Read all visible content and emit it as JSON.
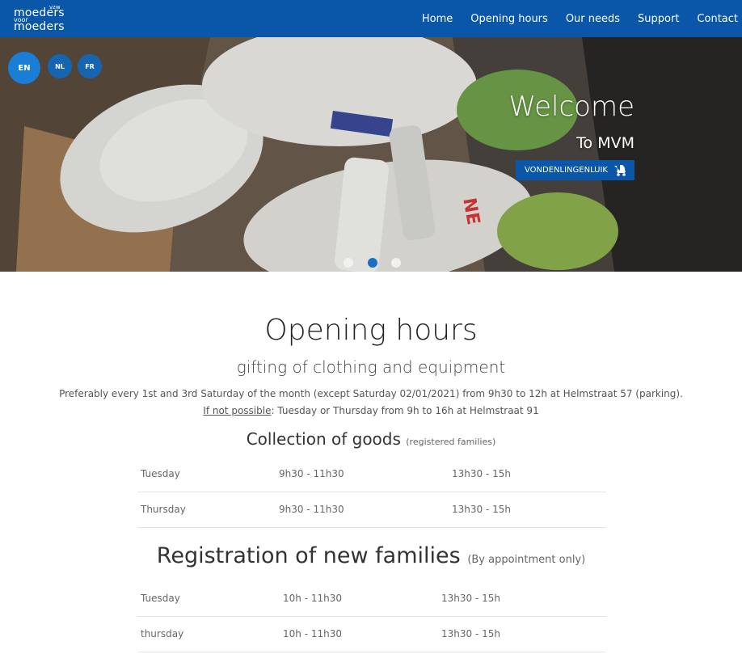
{
  "brand": {
    "line1": "moeders",
    "tag": "vzw",
    "voor": "voor",
    "line2": "moeders"
  },
  "nav": {
    "items": [
      {
        "label": "Home"
      },
      {
        "label": "Opening hours"
      },
      {
        "label": "Our needs"
      },
      {
        "label": "Support"
      },
      {
        "label": "Contact"
      }
    ]
  },
  "languages": [
    {
      "code": "EN",
      "active": true
    },
    {
      "code": "NL",
      "active": false
    },
    {
      "code": "FR",
      "active": false
    }
  ],
  "hero": {
    "title": "Welcome",
    "subtitle": "To MVM",
    "button_label": "VONDENLINGENLUIK",
    "button_icon": "baby-carriage-icon",
    "slides": 3,
    "active_slide": 2
  },
  "main": {
    "title": "Opening hours",
    "subtitle": "gifting of clothing and equipment",
    "paragraph1": "Preferably every 1st and 3rd Saturday of the month (except Saturday 02/01/2021) from 9h30 to 12h at Helmstraat 57 (parking).",
    "paragraph2_underlined": "If not possible",
    "paragraph2_rest": ": Tuesday or Thursday from 9h to 16h at Helmstraat 91",
    "collection": {
      "heading": "Collection of goods",
      "note": "(registered families)",
      "rows": [
        [
          "Tuesday",
          "9h30 - 11h30",
          "13h30 - 15h"
        ],
        [
          "Thursday",
          "9h30 - 11h30",
          "13h30 - 15h"
        ]
      ]
    },
    "registration": {
      "heading": "Registration of new families",
      "note": "(By appointment only)",
      "rows": [
        [
          "Tuesday",
          "10h - 11h30",
          "13h30 - 15h"
        ],
        [
          "thursday",
          "10h - 11h30",
          "13h30 - 15h"
        ]
      ]
    }
  },
  "colors": {
    "brand_blue": "#0a56a8",
    "lang_active": "#1a7ed6"
  }
}
